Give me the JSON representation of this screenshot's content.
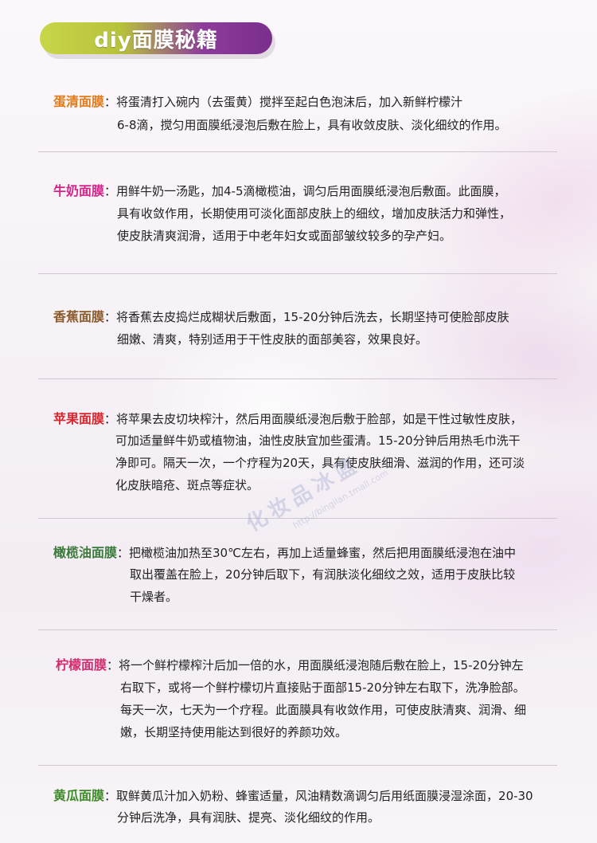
{
  "header": {
    "title": "diy面膜秘籍"
  },
  "watermark": {
    "main": "化妆品冰蓝",
    "url": "http://bingilan.tmall.com"
  },
  "colors": {
    "egg": "#e07a1a",
    "milk": "#d4238a",
    "banana": "#8a5a2a",
    "apple": "#d8262e",
    "olive": "#3a7a3a",
    "lemon": "#d42a6e",
    "cucumber": "#3f8a2a"
  },
  "sections": [
    {
      "label": "蛋清面膜",
      "lines": [
        "：将蛋清打入碗内（去蛋黄）搅拌至起白色泡沫后，加入新鲜柠檬汁",
        "6-8滴，搅匀用面膜纸浸泡后敷在脸上，具有收敛皮肤、淡化细纹的作用。"
      ]
    },
    {
      "label": "牛奶面膜",
      "lines": [
        "：用鲜牛奶一汤匙，加4-5滴橄榄油，调匀后用面膜纸浸泡后敷面。此面膜，",
        "具有收敛作用，长期使用可淡化面部皮肤上的细纹，增加皮肤活力和弹性，",
        "使皮肤清爽润滑，适用于中老年妇女或面部皱纹较多的孕产妇。"
      ]
    },
    {
      "label": "香蕉面膜",
      "lines": [
        "：将香蕉去皮捣烂成糊状后敷面，15-20分钟后洗去，长期坚持可使脸部皮肤",
        "细嫩、清爽，特别适用于干性皮肤的面部美容，效果良好。"
      ]
    },
    {
      "label": "苹果面膜",
      "lines": [
        "：将苹果去皮切块榨汁，然后用面膜纸浸泡后敷于脸部，如是干性过敏性皮肤，",
        "可加适量鲜牛奶或植物油，油性皮肤宜加些蛋清。15-20分钟后用热毛巾洗干",
        "净即可。隔天一次，一个疗程为20天，具有使皮肤细滑、滋润的作用，还可淡",
        "化皮肤暗疮、斑点等症状。"
      ]
    },
    {
      "label": "橄榄油面膜",
      "lines": [
        "：把橄榄油加热至30℃左右，再加上适量蜂蜜，然后把用面膜纸浸泡在油中",
        "取出覆盖在脸上，20分钟后取下，有润肤淡化细纹之效，适用于皮肤比较",
        "干燥者。"
      ]
    },
    {
      "label": "柠檬面膜",
      "lines": [
        "：将一个鲜柠檬榨汁后加一倍的水，用面膜纸浸泡随后敷在脸上，15-20分钟左",
        "右取下，或将一个鲜柠檬切片直接贴于面部15-20分钟左右取下，洗净脸部。",
        "每天一次，七天为一个疗程。此面膜具有收敛作用，可使皮肤清爽、润滑、细",
        "嫩，长期坚持使用能达到很好的养颜功效。"
      ]
    },
    {
      "label": "黄瓜面膜",
      "lines": [
        "：取鲜黄瓜汁加入奶粉、蜂蜜适量，风油精数滴调匀后用纸面膜浸湿涂面，20-30",
        "分钟后洗净，具有润肤、提亮、淡化细纹的作用。"
      ]
    }
  ]
}
